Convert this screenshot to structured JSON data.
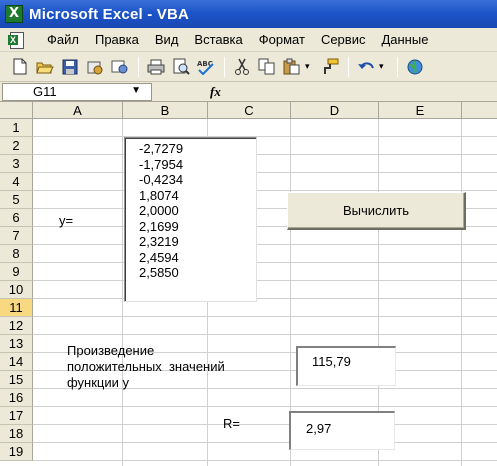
{
  "window": {
    "title": "Microsoft Excel - VBA"
  },
  "menu": [
    "Файл",
    "Правка",
    "Вид",
    "Вставка",
    "Формат",
    "Сервис",
    "Данные"
  ],
  "formula_bar": {
    "name_box": "G11",
    "fx": "fx",
    "formula": ""
  },
  "columns": [
    "A",
    "B",
    "C",
    "D",
    "E"
  ],
  "rows": [
    "1",
    "2",
    "3",
    "4",
    "5",
    "6",
    "7",
    "8",
    "9",
    "10",
    "11",
    "12",
    "13",
    "14",
    "15",
    "16",
    "17",
    "18",
    "19"
  ],
  "active_row": "11",
  "sheet": {
    "y_label": "y=",
    "listbox_values": [
      "-2,7279",
      "-1,7954",
      "-0,4234",
      "1,8074",
      "2,0000",
      "2,1699",
      "2,3219",
      "2,4594",
      "2,5850"
    ],
    "calc_button": "Вычислить",
    "product_label": [
      "Произведение",
      "положительных  значений",
      "функции y"
    ],
    "product_value": "115,79",
    "r_label": "R=",
    "r_value": "2,97"
  },
  "toolbar_icons": [
    "new-icon",
    "open-icon",
    "save-icon",
    "permission-icon",
    "email-icon",
    "print-icon",
    "print-preview-icon",
    "spelling-icon",
    "cut-icon",
    "copy-icon",
    "paste-icon",
    "format-painter-icon",
    "undo-icon",
    "hyperlink-icon"
  ]
}
